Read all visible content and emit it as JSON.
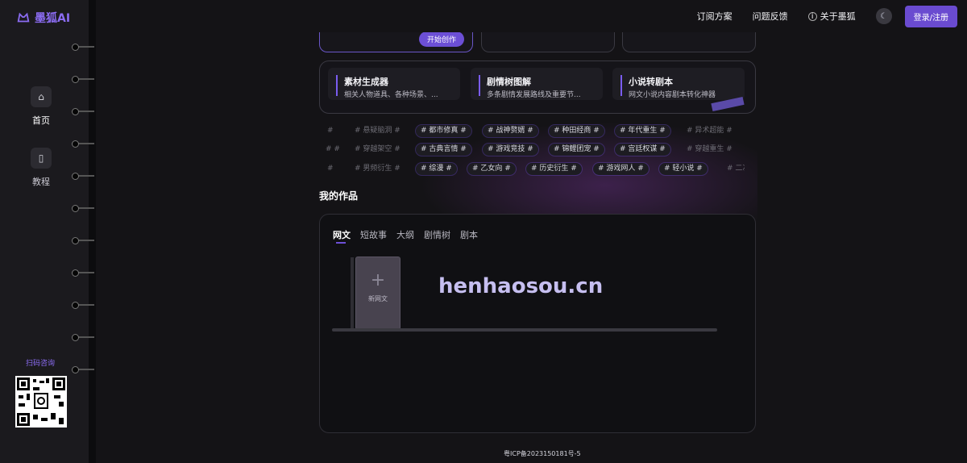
{
  "app": {
    "logo_text": "墨狐AI"
  },
  "topnav": {
    "subscribe": "订阅方案",
    "feedback": "问题反馈",
    "about": "关于墨狐",
    "login": "登录/注册"
  },
  "sidebar": {
    "items": [
      {
        "label": "首页"
      },
      {
        "label": "教程"
      }
    ],
    "qr_label": "扫码咨询"
  },
  "top_cards": {
    "start_button": "开始创作"
  },
  "tools": [
    {
      "title": "素材生成器",
      "desc": "相关人物道具、各种场景、..."
    },
    {
      "title": "剧情树图解",
      "desc": "多条剧情发展路线及重要节..."
    },
    {
      "title": "小说转剧本",
      "desc": "网文小说内容剧本转化神器"
    }
  ],
  "tags": {
    "row1": [
      "# 悬疑脑洞 #",
      "# 都市修真 #",
      "# 战神赘婿 #",
      "# 种田经商 #",
      "# 年代重生 #",
      "# 异术超能 #"
    ],
    "row2": [
      "# 穿越架空 #",
      "# 古典言情 #",
      "# 游戏竞技 #",
      "# 锦鲤团宠 #",
      "# 宫廷权谋 #",
      "# 穿越重生 #"
    ],
    "row3": [
      "# 男频衍生 #",
      "# 综漫 #",
      "# 乙女向 #",
      "# 历史衍生 #",
      "# 游戏网人 #",
      "# 轻小说 #",
      "# 二次"
    ]
  },
  "works": {
    "title": "我的作品",
    "tabs": [
      "网文",
      "短故事",
      "大纲",
      "剧情树",
      "剧本"
    ],
    "new_label": "新网文"
  },
  "watermark": "henhaosou.cn",
  "footer": {
    "icp": "粤ICP备2023150181号-5"
  },
  "colors": {
    "accent": "#6c4fd6",
    "background": "#141316",
    "sidebar": "#1b1a1e"
  }
}
